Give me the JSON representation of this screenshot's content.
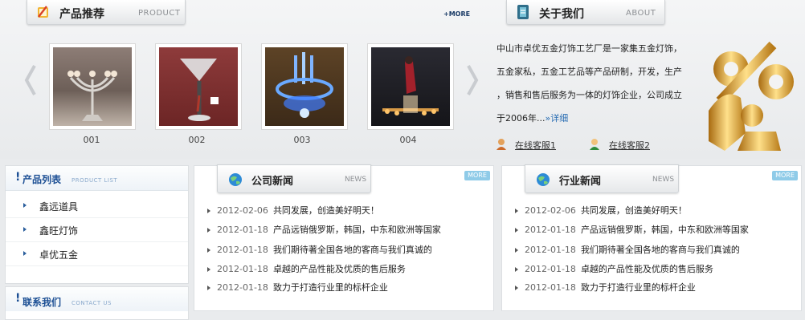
{
  "products_header": {
    "title": "产品推荐",
    "en": "PRODUCT",
    "more": "+MORE"
  },
  "products": [
    {
      "caption": "001"
    },
    {
      "caption": "002"
    },
    {
      "caption": "003"
    },
    {
      "caption": "004"
    }
  ],
  "about_header": {
    "title": "关于我们",
    "en": "ABOUT"
  },
  "about": {
    "lines": [
      "中山市卓优五金灯饰工艺厂是一家集五金灯饰，",
      "五金家私，五金工艺品等产品研制，开发，生产",
      "，销售和售后服务为一体的灯饰企业，公司成立",
      "于2006年..."
    ],
    "more": "»详细",
    "services": [
      "在线客服1",
      "在线客服2"
    ]
  },
  "sidebar": {
    "product_list": {
      "title": "产品列表",
      "en": "PRODUCT LIST",
      "items": [
        "鑫远道具",
        "鑫旺灯饰",
        "卓优五金"
      ]
    },
    "contact": {
      "title": "联系我们",
      "en": "CONTACT US"
    }
  },
  "company_news": {
    "title": "公司新闻",
    "en": "NEWS",
    "more": "MORE",
    "items": [
      {
        "date": "2012-02-06",
        "text": "共同发展，创造美好明天！"
      },
      {
        "date": "2012-01-18",
        "text": "产品远销俄罗斯，韩国，中东和欧洲等国家"
      },
      {
        "date": "2012-01-18",
        "text": "我们期待著全国各地的客商与我们真诚的"
      },
      {
        "date": "2012-01-18",
        "text": "卓越的产品性能及优质的售后服务"
      },
      {
        "date": "2012-01-18",
        "text": "致力于打造行业里的标杆企业"
      }
    ]
  },
  "industry_news": {
    "title": "行业新闻",
    "en": "NEWS",
    "more": "MORE",
    "items": [
      {
        "date": "2012-02-06",
        "text": "共同发展，创造美好明天！"
      },
      {
        "date": "2012-01-18",
        "text": "产品远销俄罗斯，韩国，中东和欧洲等国家"
      },
      {
        "date": "2012-01-18",
        "text": "我们期待著全国各地的客商与我们真诚的"
      },
      {
        "date": "2012-01-18",
        "text": "卓越的产品性能及优质的售后服务"
      },
      {
        "date": "2012-01-18",
        "text": "致力于打造行业里的标杆企业"
      }
    ]
  },
  "colors": {
    "accent": "#1c4f94",
    "link": "#2a6db3",
    "more_badge": "#8fcbe8"
  }
}
